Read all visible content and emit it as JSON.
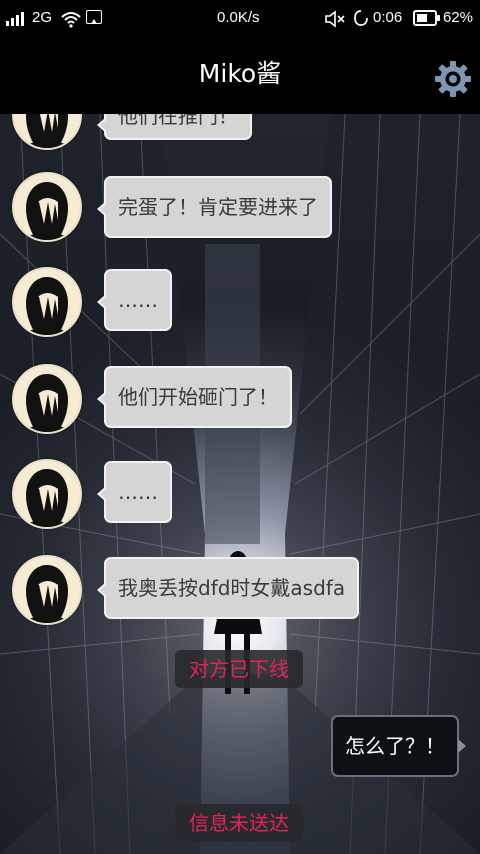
{
  "status_bar": {
    "network": "2G",
    "speed": "0.0K/s",
    "time": "0:06",
    "battery": "62%",
    "battery_level": 0.62,
    "icons": [
      "signal-icon",
      "wifi-icon",
      "gallery-icon",
      "mute-icon",
      "alarm-icon",
      "battery-icon"
    ]
  },
  "header": {
    "title": "Miko酱",
    "settings_icon": "gear-icon"
  },
  "colors": {
    "gear": "#7f95b4",
    "notice_text": "#e0245a",
    "bubble_incoming": "#d5d5d5",
    "bubble_outgoing": "#0d1014"
  },
  "messages": [
    {
      "from": "them",
      "text": "他们在推门！"
    },
    {
      "from": "them",
      "text": "完蛋了！肯定要进来了"
    },
    {
      "from": "them",
      "text": "……"
    },
    {
      "from": "them",
      "text": "他们开始砸门了！"
    },
    {
      "from": "them",
      "text": "……"
    },
    {
      "from": "them",
      "text": "我奥丢按dfd时女戴asdfa"
    }
  ],
  "system_notice": "对方已下线",
  "sent_message": {
    "from": "me",
    "text": "怎么了？！"
  },
  "send_error": "信息未送达"
}
